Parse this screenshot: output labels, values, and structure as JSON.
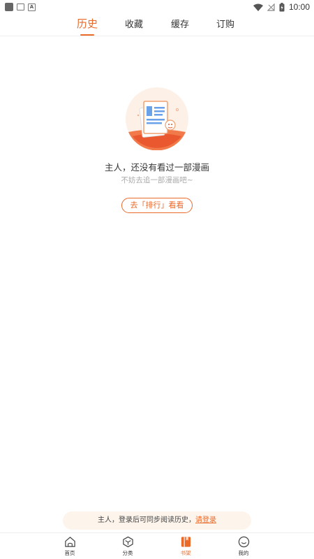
{
  "status_bar": {
    "time": "10:00"
  },
  "tabs": [
    {
      "label": "历史",
      "active": true
    },
    {
      "label": "收藏",
      "active": false
    },
    {
      "label": "缓存",
      "active": false
    },
    {
      "label": "订购",
      "active": false
    }
  ],
  "empty_state": {
    "title": "主人，还没有看过一部漫画",
    "subtitle": "不妨去追一部漫画吧~",
    "button_label": "去「排行」看看"
  },
  "login_banner": {
    "text": "主人，登录后可同步阅读历史，",
    "link": "请登录"
  },
  "bottom_nav": [
    {
      "label": "首页",
      "icon": "home-icon",
      "active": false
    },
    {
      "label": "分类",
      "icon": "category-icon",
      "active": false
    },
    {
      "label": "书架",
      "icon": "bookshelf-icon",
      "active": true
    },
    {
      "label": "我的",
      "icon": "profile-icon",
      "active": false
    }
  ],
  "colors": {
    "accent": "#ea6a2a",
    "banner_bg": "#fdf4ec"
  }
}
